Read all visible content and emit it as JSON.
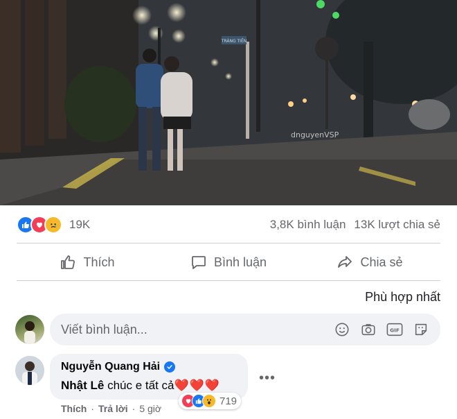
{
  "photo": {
    "watermark": "dnguyenVSP",
    "street_sign": "TRÀNG TIỀN",
    "subject_icon": "couple-walking-night-street-icon"
  },
  "stats": {
    "reaction_icons": [
      "like-icon",
      "love-icon",
      "sad-icon"
    ],
    "reaction_count": "19K",
    "comments": "3,8K bình luận",
    "shares": "13K lượt chia sẻ"
  },
  "actions": {
    "like": "Thích",
    "comment": "Bình luận",
    "share": "Chia sẻ"
  },
  "sort": {
    "label": "Phù hợp nhất"
  },
  "composer": {
    "placeholder": "Viết bình luận...",
    "icons": [
      "emoji-icon",
      "camera-icon",
      "gif-icon",
      "sticker-icon"
    ]
  },
  "comment": {
    "author": "Nguyễn Quang Hải",
    "verified": true,
    "mention": "Nhật Lê",
    "text": "chúc e tất cả",
    "hearts": "❤️❤️❤️",
    "reaction_icons": [
      "love-icon",
      "like-icon",
      "wow-icon"
    ],
    "reaction_count": "719",
    "like_label": "Thích",
    "reply_label": "Trả lời",
    "time": "5 giờ"
  },
  "colors": {
    "like_blue": "#1877f2",
    "love_red": "#f33e58",
    "sad_yellow": "#f7b928",
    "secondary_text": "#65676b"
  }
}
